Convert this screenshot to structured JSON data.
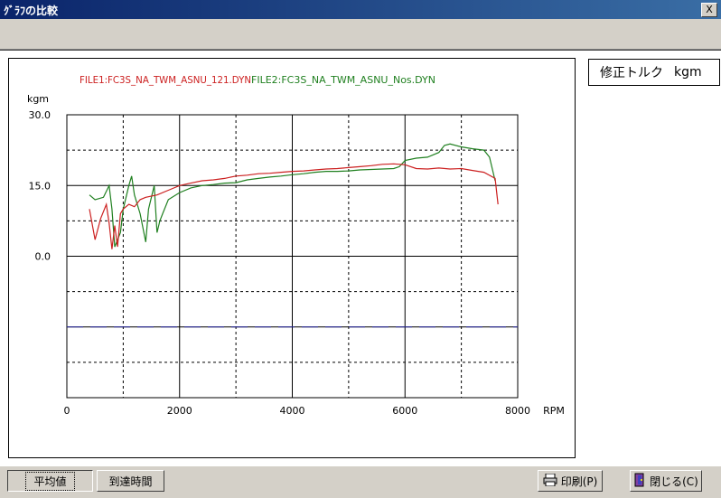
{
  "window": {
    "title": "ｸﾞﾗﾌの比較",
    "close_label": "X"
  },
  "legend_panel": {
    "label": "修正トルク",
    "unit": "kgm"
  },
  "colors": {
    "file1": "#cc2020",
    "file2": "#208020",
    "ref_line": "#2a2aa0"
  },
  "chart_data": {
    "type": "line",
    "title": "",
    "xlabel": "RPM",
    "ylabel": "kgm",
    "xlim": [
      0,
      8000
    ],
    "ylim": [
      -30,
      30
    ],
    "x_ticks": [
      "0",
      "2000",
      "4000",
      "6000",
      "8000"
    ],
    "y_ticks": [
      "30.0",
      "15.0",
      "0.0"
    ],
    "grid": true,
    "legend_position": "top",
    "reference_line": {
      "y": -15,
      "style": "dashed"
    },
    "series": [
      {
        "name": "FILE1:FC3S_NA_TWM_ASNU_121.DYN",
        "x": [
          400,
          500,
          600,
          700,
          750,
          800,
          850,
          900,
          950,
          1000,
          1100,
          1200,
          1300,
          1400,
          1600,
          1800,
          2000,
          2200,
          2400,
          2600,
          2800,
          3000,
          3200,
          3400,
          3600,
          3800,
          4000,
          4200,
          4400,
          4600,
          4800,
          5000,
          5200,
          5400,
          5600,
          5800,
          6000,
          6200,
          6400,
          6600,
          6800,
          7000,
          7200,
          7400,
          7600,
          7650
        ],
        "y": [
          10,
          3.5,
          8,
          11,
          7,
          1.5,
          6.5,
          2,
          9,
          10,
          11,
          10.5,
          12,
          12.5,
          13,
          14,
          15,
          15.5,
          16,
          16.2,
          16.5,
          17,
          17.2,
          17.5,
          17.6,
          17.8,
          18,
          18.1,
          18.3,
          18.5,
          18.6,
          18.8,
          19,
          19.2,
          19.5,
          19.6,
          19.4,
          18.6,
          18.5,
          18.7,
          18.5,
          18.6,
          18.2,
          17.8,
          16.5,
          11
        ]
      },
      {
        "name": "FILE2:FC3S_NA_TWM_ASNU_Nos.DYN",
        "x": [
          400,
          500,
          650,
          750,
          800,
          850,
          950,
          1000,
          1100,
          1150,
          1200,
          1300,
          1400,
          1450,
          1550,
          1600,
          1650,
          1700,
          1800,
          2000,
          2200,
          2400,
          2600,
          2800,
          3000,
          3200,
          3400,
          3600,
          3800,
          4000,
          4200,
          4400,
          4600,
          4800,
          5000,
          5200,
          5400,
          5600,
          5800,
          5900,
          6000,
          6200,
          6400,
          6600,
          6700,
          6800,
          7000,
          7200,
          7400,
          7500,
          7600
        ],
        "y": [
          13,
          12,
          12.5,
          15,
          10,
          2,
          5,
          10,
          15,
          17,
          13,
          9,
          3,
          10,
          15,
          5,
          7.5,
          9,
          12,
          13.5,
          14.5,
          15,
          15.2,
          15.5,
          15.6,
          16.2,
          16.5,
          16.8,
          17,
          17.3,
          17.5,
          17.8,
          18,
          18,
          18.1,
          18.3,
          18.4,
          18.5,
          18.6,
          19,
          20.3,
          20.8,
          21,
          22,
          23.5,
          23.8,
          23.2,
          22.8,
          22.5,
          21,
          16
        ]
      }
    ]
  },
  "buttons": {
    "average": "平均値",
    "reach_time": "到達時間",
    "print": "印刷(P)",
    "close": "閉じる(C)"
  }
}
